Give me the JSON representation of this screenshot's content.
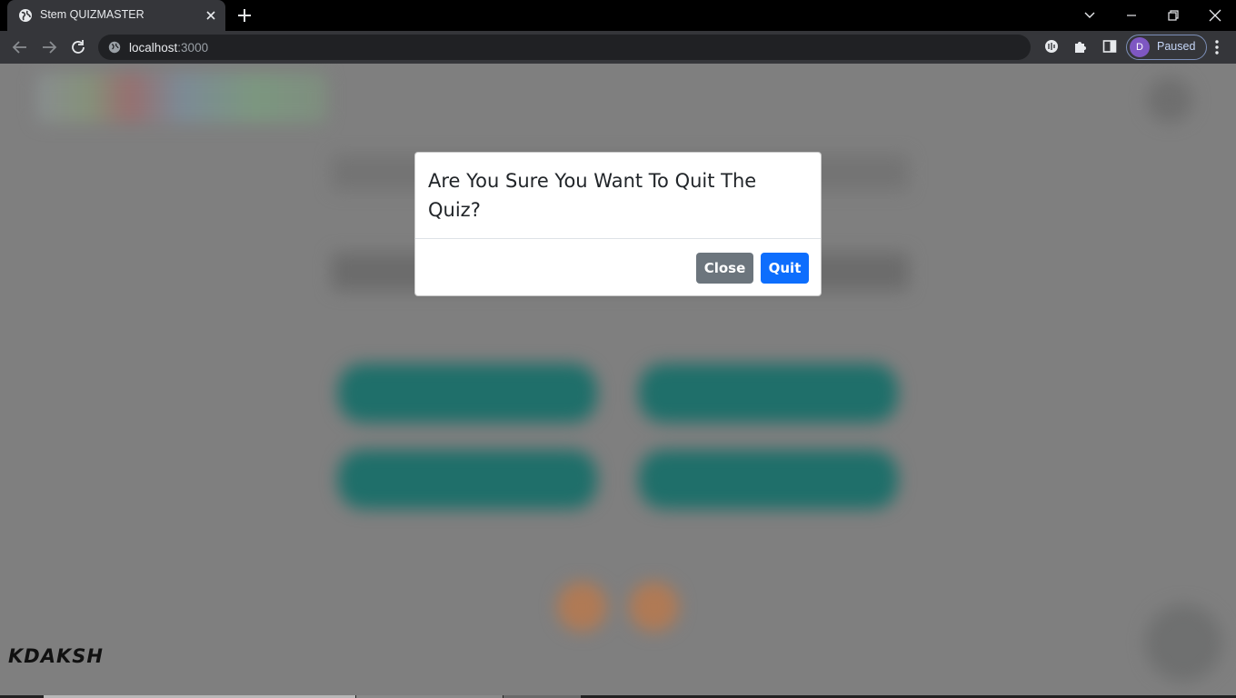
{
  "browser": {
    "tab_title": "Stem QUIZMASTER",
    "url_host": "localhost",
    "url_port": ":3000",
    "profile_initial": "D",
    "profile_status": "Paused",
    "accent": "#7e57c2"
  },
  "page": {
    "brand": "KDAKSH"
  },
  "modal": {
    "title": "Are You Sure You Want To Quit The Quiz?",
    "close_label": "Close",
    "quit_label": "Quit",
    "close_color": "#6c757d",
    "quit_color": "#0d6efd"
  },
  "icons": [
    "globe-favicon-icon",
    "close-tab-icon",
    "new-tab-icon",
    "tab-search-icon",
    "minimize-icon",
    "restore-icon",
    "close-window-icon",
    "back-icon",
    "forward-icon",
    "reload-icon",
    "site-info-icon",
    "media-icon",
    "extensions-icon",
    "side-panel-icon",
    "menu-icon"
  ]
}
